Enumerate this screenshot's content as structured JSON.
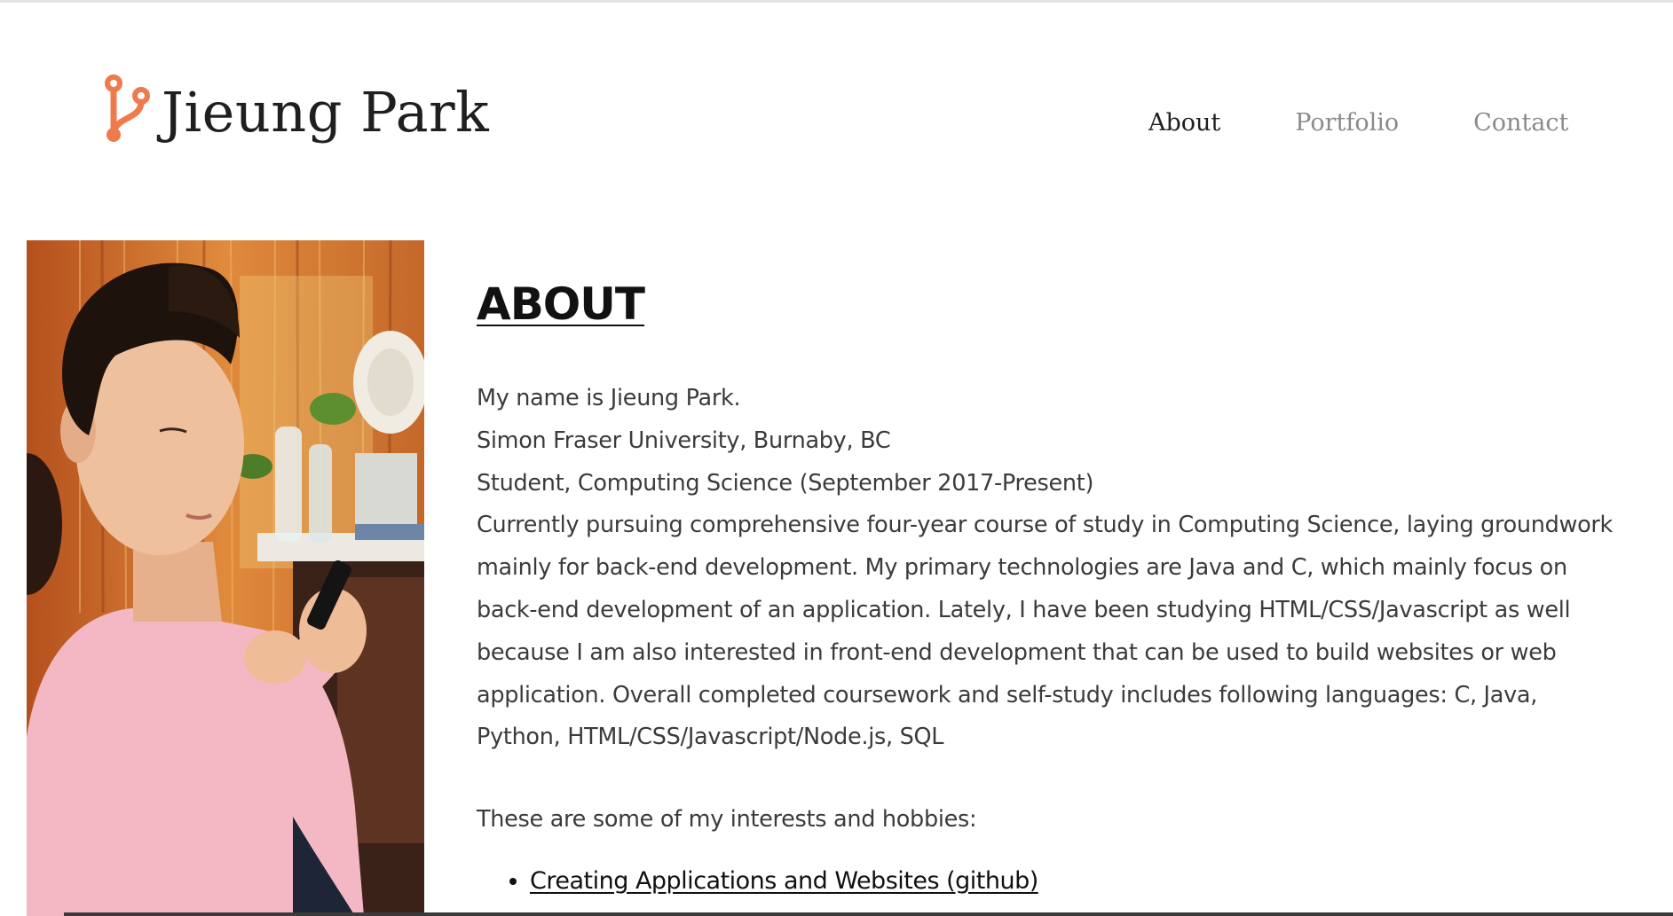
{
  "brand": {
    "name": "Jieung Park",
    "icon": "git-branch-icon",
    "accent_color": "#ef7a4c"
  },
  "nav": {
    "items": [
      {
        "label": "About",
        "active": true
      },
      {
        "label": "Portfolio",
        "active": false
      },
      {
        "label": "Contact",
        "active": false
      }
    ]
  },
  "photo": {
    "subject": "profile-photo"
  },
  "about": {
    "title": "ABOUT",
    "bio_lines": [
      "My name is Jieung Park.",
      "Simon Fraser University, Burnaby, BC",
      "Student, Computing Science (September 2017-Present)",
      "Currently pursuing comprehensive four-year course of study in Computing Science, laying groundwork mainly for back-end development. My primary technologies are Java and C, which mainly focus on back-end development of an application. Lately, I have been studying HTML/CSS/Javascript as well because I am also interested in front-end development that can be used to build websites or web application. Overall completed coursework and self-study includes following languages: C, Java, Python, HTML/CSS/Javascript/Node.js, SQL"
    ],
    "hobbies_intro": "These are some of my interests and hobbies:",
    "hobbies": [
      {
        "label": "Creating Applications and Websites (github)"
      }
    ]
  }
}
